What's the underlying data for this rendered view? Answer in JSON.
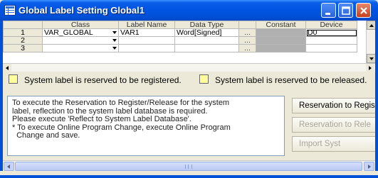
{
  "window": {
    "title": "Global Label Setting Global1"
  },
  "grid": {
    "columns": [
      "",
      "Class",
      "Label Name",
      "Data Type",
      "",
      "Constant",
      "Device"
    ],
    "rows": [
      {
        "num": "1",
        "class": "VAR_GLOBAL",
        "label_name": "VAR1",
        "data_type": "Word[Signed]",
        "dots": "...",
        "constant": "",
        "device": "D0"
      },
      {
        "num": "2",
        "class": "",
        "label_name": "",
        "data_type": "",
        "dots": "...",
        "constant": "",
        "device": ""
      },
      {
        "num": "3",
        "class": "",
        "label_name": "",
        "data_type": "",
        "dots": "...",
        "constant": "",
        "device": ""
      }
    ]
  },
  "legend": {
    "registered": "System label is reserved to be registered.",
    "released": "System label is reserved to be released.",
    "color": "#ffff9c"
  },
  "info": {
    "lines": [
      "To execute the Reservation to Register/Release for the system",
      "label, reflection to the system label database is required.",
      "Please execute 'Reflect to System Label Database'.",
      "* To execute Online Program Change, execute Online Program",
      "  Change and save."
    ]
  },
  "buttons": {
    "reserve_register": "Reservation to Regis",
    "reserve_release": "Reservation to Rele",
    "import": "Import Syst"
  },
  "colors": {
    "titlebar": "#0054e3",
    "dialog": "#ece9d8",
    "disabled_cell": "#b0b0b0"
  }
}
